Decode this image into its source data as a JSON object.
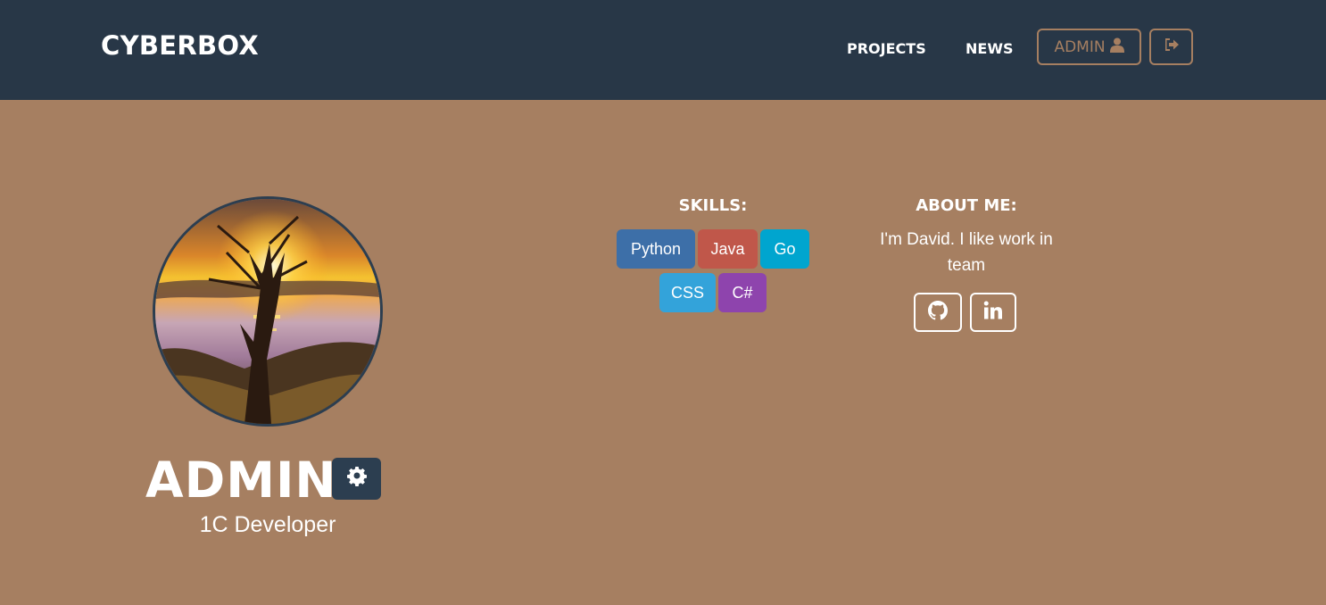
{
  "navbar": {
    "brand": "CYBERBOX",
    "links": [
      "PROJECTS",
      "NEWS"
    ],
    "admin_button": "ADMIN",
    "icons": [
      "user-icon",
      "sign-out-icon"
    ],
    "background": "#283747",
    "accent": "#a67f61"
  },
  "profile": {
    "name": "ADMIN",
    "role": "1C Developer",
    "avatar_description_icon": "profile-photo",
    "settings_icon": "gear-icon"
  },
  "skills": {
    "title": "SKILLS:",
    "items": [
      {
        "label": "Python",
        "color": "#3d6fa8"
      },
      {
        "label": "Java",
        "color": "#c0574a"
      },
      {
        "label": "Go",
        "color": "#00a5cf"
      },
      {
        "label": "CSS",
        "color": "#33a3da"
      },
      {
        "label": "C#",
        "color": "#8e44ad"
      }
    ]
  },
  "about": {
    "title": "ABOUT ME:",
    "text": "I'm David. I like work in team",
    "social_icons": [
      "github-icon",
      "linkedin-icon"
    ]
  },
  "page": {
    "background": "#a67f61"
  }
}
